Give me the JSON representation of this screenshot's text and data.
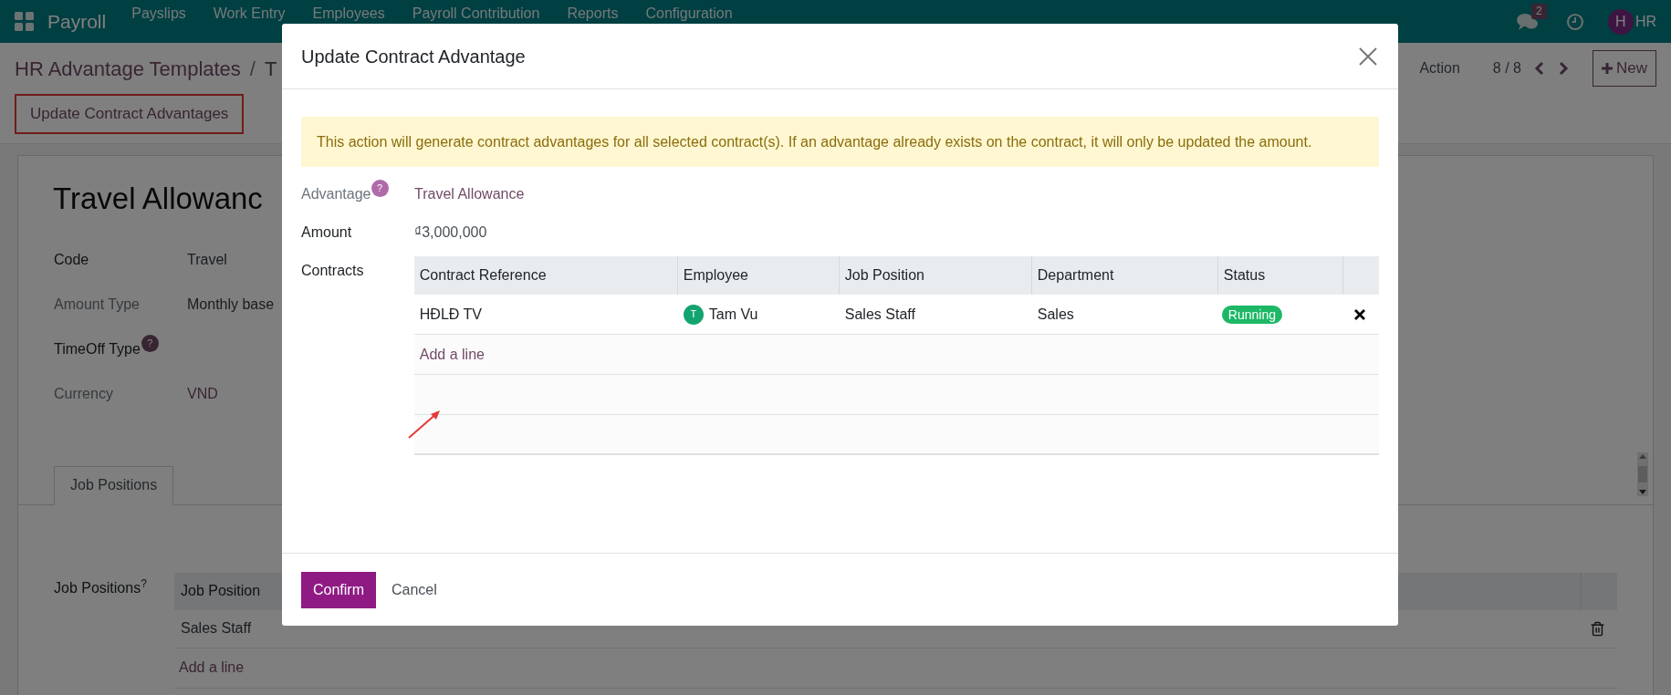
{
  "navbar": {
    "app_name": "Payroll",
    "menu": [
      "Payslips",
      "Work Entry",
      "Employees",
      "Payroll Contribution",
      "Reports",
      "Configuration"
    ],
    "messages_badge": "2",
    "avatar_initial": "H",
    "user_name": "HR"
  },
  "control_panel": {
    "breadcrumb": [
      "HR Advantage Templates",
      "T"
    ],
    "separator": "/",
    "action_label": "Action",
    "pager": "8 / 8",
    "new_button": "New",
    "highlighted_button": "Update Contract Advantages"
  },
  "form": {
    "title": "Travel Allowanc",
    "fields": [
      {
        "label": "Code",
        "value": "Travel",
        "required": true,
        "help": false,
        "link": false
      },
      {
        "label": "Amount Type",
        "value": "Monthly base",
        "required": false,
        "help": false,
        "link": false
      },
      {
        "label": "TimeOff Type",
        "required": true,
        "help": true
      },
      {
        "label": "Currency",
        "value": "VND",
        "required": false,
        "help": false,
        "link": true
      }
    ],
    "help_mark": "?",
    "tabs": [
      {
        "label": "Job Positions",
        "selected": true
      }
    ],
    "job_positions": {
      "label": "Job Positions$^{?}$",
      "columns": [
        "Job Position"
      ],
      "rows": [
        [
          "Sales Staff"
        ]
      ],
      "add_line": "Add a line"
    }
  },
  "dialog": {
    "title": "Update Contract Advantage",
    "alert": "This action will generate contract advantages for all selected contract(s). If an advantage already exists on the contract, it will only be updated the amount.",
    "advantage": {
      "label": "Advantage",
      "help_mark": "?",
      "value": "Travel Allowance"
    },
    "amount": {
      "label": "Amount",
      "value": "₫3,000,000"
    },
    "contracts": {
      "label": "Contracts",
      "columns": [
        "Contract Reference",
        "Employee",
        "Job Position",
        "Department",
        "Status"
      ],
      "rows": [
        {
          "reference": "HĐLĐ TV",
          "employee_initial": "T",
          "employee": "Tam Vu",
          "job_position": "Sales Staff",
          "department": "Sales",
          "status": "Running"
        }
      ],
      "add_line": "Add a line"
    },
    "confirm": "Confirm",
    "cancel": "Cancel"
  }
}
